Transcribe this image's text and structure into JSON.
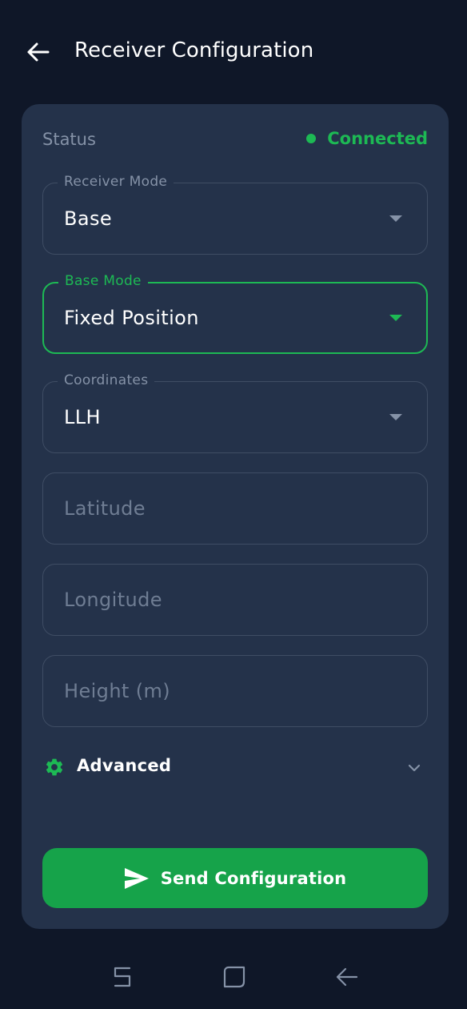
{
  "appbar": {
    "title": "Receiver Configuration",
    "back_icon": "arrow-left-icon"
  },
  "status": {
    "label": "Status",
    "value": "Connected",
    "color": "#1db954"
  },
  "fields": {
    "receiver_mode": {
      "label": "Receiver Mode",
      "value": "Base"
    },
    "base_mode": {
      "label": "Base Mode",
      "value": "Fixed Position"
    },
    "coordinates": {
      "label": "Coordinates",
      "value": "LLH"
    }
  },
  "inputs": {
    "latitude": {
      "placeholder": "Latitude",
      "value": ""
    },
    "longitude": {
      "placeholder": "Longitude",
      "value": ""
    },
    "height": {
      "placeholder": "Height (m)",
      "value": ""
    }
  },
  "advanced": {
    "label": "Advanced",
    "icon": "gear-icon",
    "toggle_icon": "chevron-down-icon"
  },
  "send_button": {
    "label": "Send Configuration",
    "icon": "send-icon"
  },
  "navbar": {
    "items": [
      "recent-apps-icon",
      "home-icon",
      "back-icon"
    ]
  },
  "colors": {
    "background": "#0f1728",
    "card": "#24324a",
    "accent": "#1db954",
    "button": "#16a34a",
    "border": "#3f4d64",
    "muted": "#8592a7"
  }
}
